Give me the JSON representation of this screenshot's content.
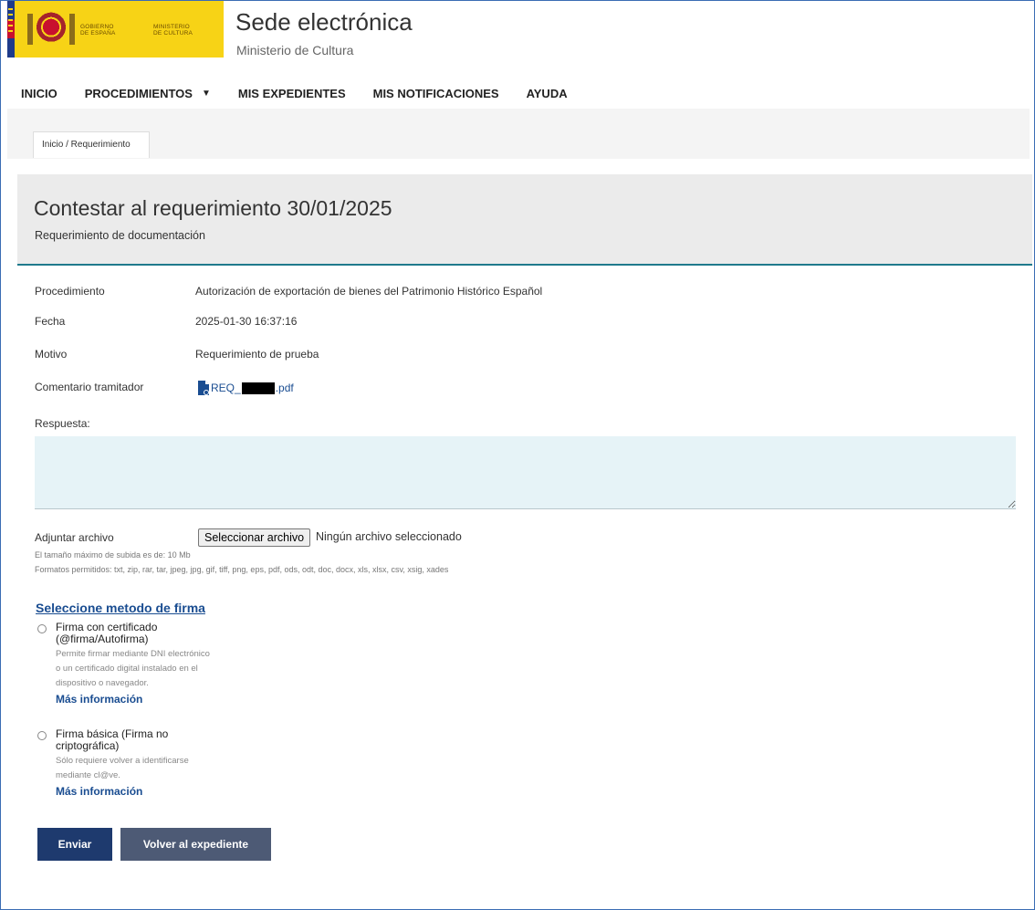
{
  "header": {
    "logo_gobierno": "GOBIERNO\nDE ESPAÑA",
    "logo_ministerio": "MINISTERIO\nDE CULTURA",
    "title": "Sede electrónica",
    "subtitle": "Ministerio de Cultura"
  },
  "nav": {
    "items": [
      "INICIO",
      "PROCEDIMIENTOS",
      "MIS EXPEDIENTES",
      "MIS NOTIFICACIONES",
      "AYUDA"
    ]
  },
  "breadcrumb": "Inicio / Requerimiento",
  "page": {
    "title": "Contestar al requerimiento 30/01/2025",
    "subtitle": "Requerimiento de documentación"
  },
  "details": {
    "procedimiento_label": "Procedimiento",
    "procedimiento_value": "Autorización de exportación de bienes del Patrimonio Histórico Español",
    "fecha_label": "Fecha",
    "fecha_value": "2025-01-30 16:37:16",
    "motivo_label": "Motivo",
    "motivo_value": "Requerimiento de prueba",
    "comentario_label": "Comentario tramitador",
    "file_prefix": "REQ_",
    "file_suffix": ".pdf"
  },
  "respuesta": {
    "label": "Respuesta:",
    "value": ""
  },
  "attach": {
    "label": "Adjuntar archivo",
    "button": "Seleccionar archivo",
    "status": "Ningún archivo seleccionado",
    "max_size": "El tamaño máximo de subida es de: 10 Mb",
    "formats": "Formatos permitidos: txt, zip, rar, tar, jpeg, jpg, gif, tiff, png, eps, pdf, ods, odt, doc, docx, xls, xlsx, csv, xsig, xades"
  },
  "signature": {
    "title": "Seleccione metodo de firma",
    "options": [
      {
        "title": "Firma con certificado (@firma/Autofirma)",
        "desc": "Permite firmar mediante DNI electrónico o un certificado digital instalado en el dispositivo o navegador.",
        "link": "Más información"
      },
      {
        "title": "Firma básica (Firma no criptográfica)",
        "desc": "Sólo requiere volver a identificarse mediante cl@ve.",
        "link": "Más información"
      }
    ]
  },
  "buttons": {
    "send": "Enviar",
    "back": "Volver al expediente"
  },
  "colors": {
    "logo_bg": "#f7d316",
    "primary": "#1e3a6e",
    "secondary": "#4d5a75",
    "accent_line": "#1f7a8c",
    "link": "#1a4d91"
  }
}
